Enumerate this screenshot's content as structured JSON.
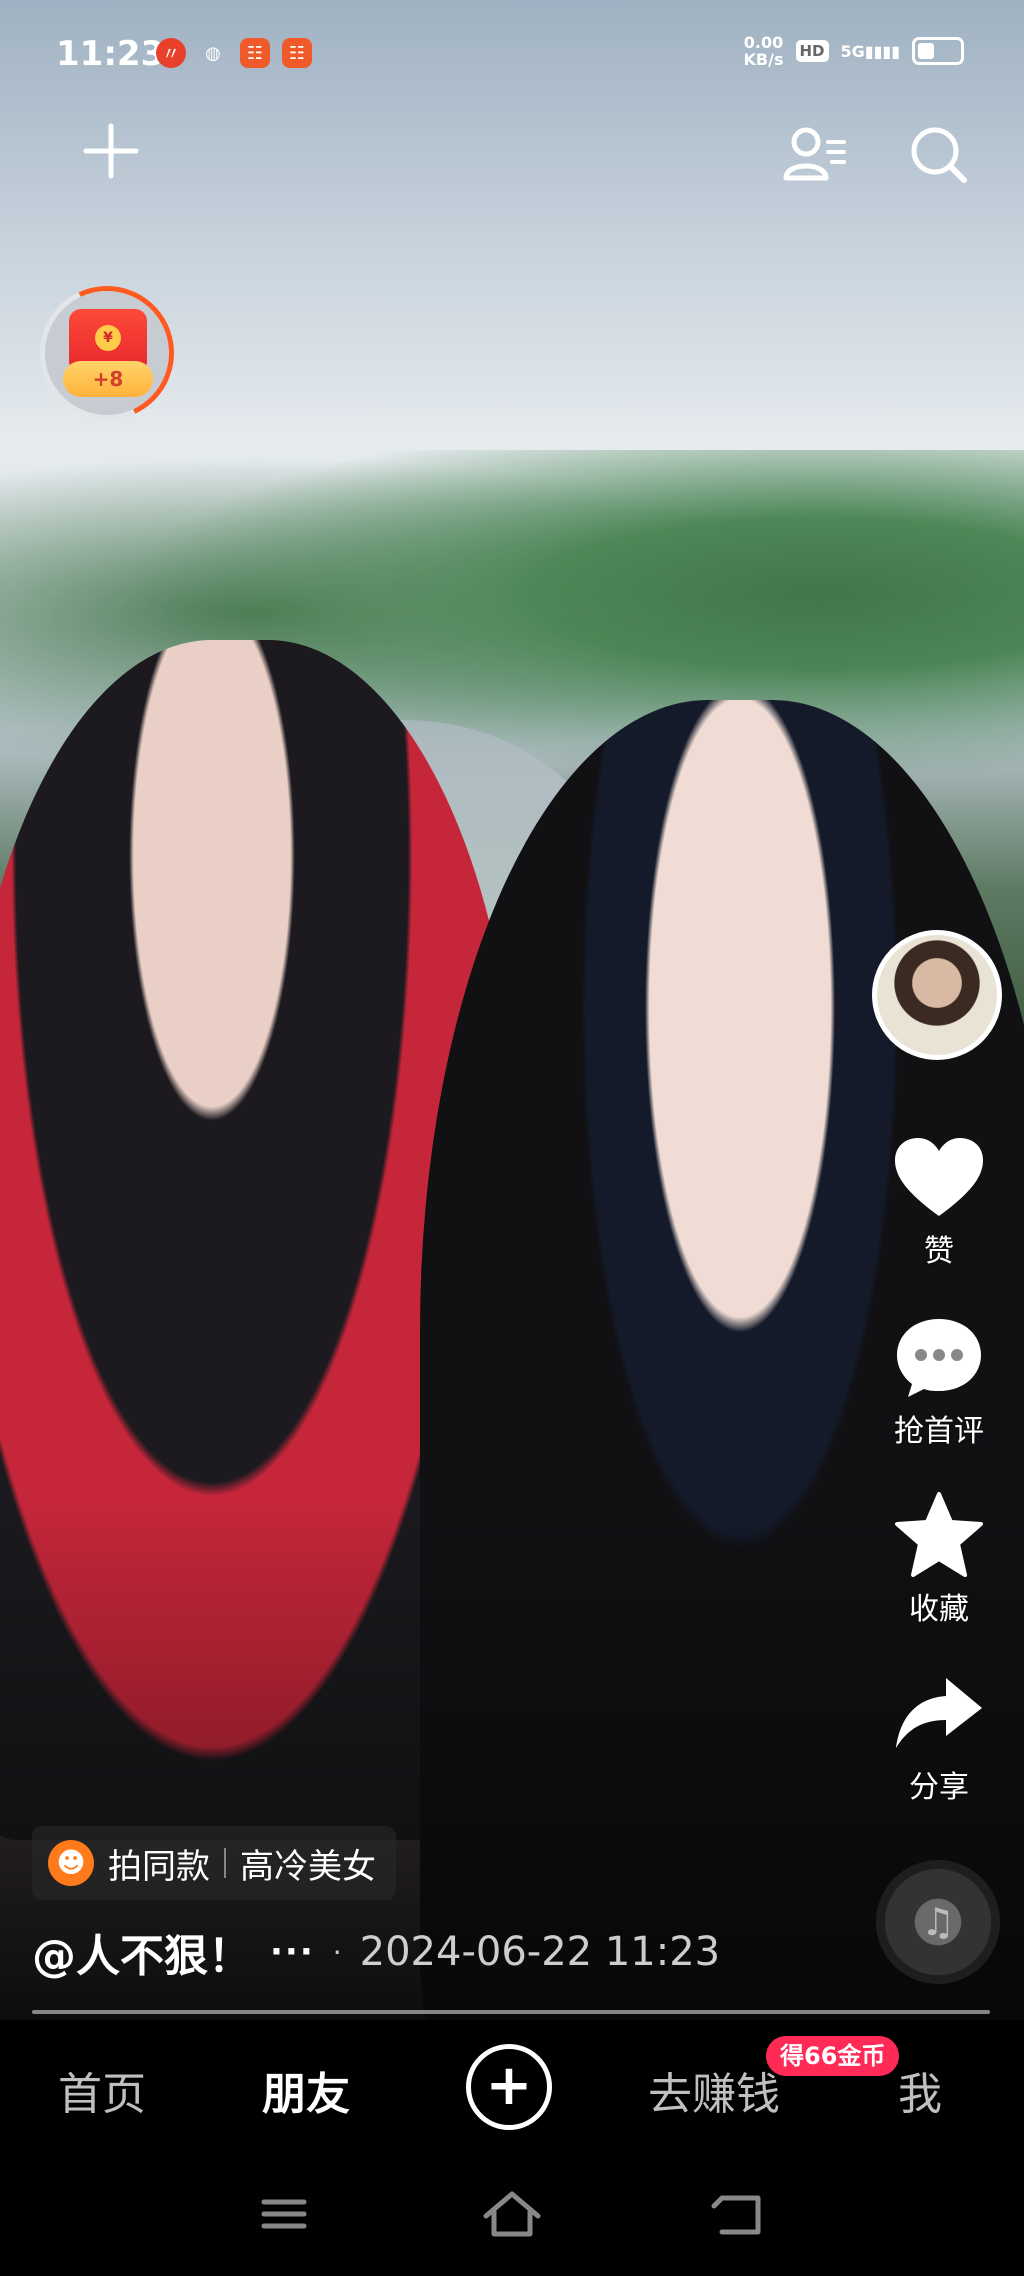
{
  "status_bar": {
    "time": "11:23",
    "net_speed_value": "0.00",
    "net_speed_unit": "KB/s",
    "hd_label": "HD",
    "network_label": "5G"
  },
  "coin_widget": {
    "envelope_symbol": "¥",
    "reward_label": "+8"
  },
  "right_rail": {
    "like_label": "赞",
    "comment_label": "抢首评",
    "favorite_label": "收藏",
    "share_label": "分享"
  },
  "template_chip": {
    "action_label": "拍同款",
    "template_name": "高冷美女"
  },
  "caption": {
    "username": "@人不狠！",
    "more": "···",
    "separator": "·",
    "date": "2024-06-22 11:23"
  },
  "bottom_nav": {
    "home": "首页",
    "friends": "朋友",
    "create": "+",
    "earn": "去赚钱",
    "earn_badge": "得66金币",
    "me": "我"
  },
  "colors": {
    "accent": "#ff2a55",
    "coin_ring": "#ff5a1f",
    "red_envelope": "#e5262a"
  }
}
